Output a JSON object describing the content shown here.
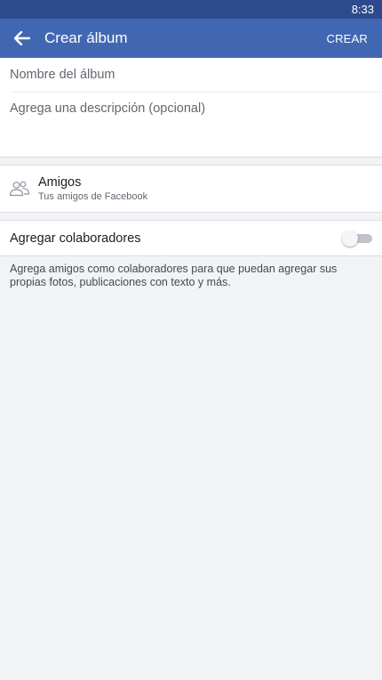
{
  "status_bar": {
    "time": "8:33"
  },
  "app_bar": {
    "title": "Crear álbum",
    "action_label": "CREAR"
  },
  "form": {
    "name_placeholder": "Nombre del álbum",
    "description_placeholder": "Agrega una descripción (opcional)"
  },
  "privacy": {
    "title": "Amigos",
    "subtitle": "Tus amigos de Facebook"
  },
  "collaborators": {
    "label": "Agregar colaboradores",
    "enabled": false,
    "help_text": "Agrega amigos como colaboradores para que puedan agregar sus propias fotos, publicaciones con texto y más."
  },
  "colors": {
    "brand": "#4267b2",
    "status_bar": "#2d4b8c",
    "background": "#f2f3f5"
  }
}
